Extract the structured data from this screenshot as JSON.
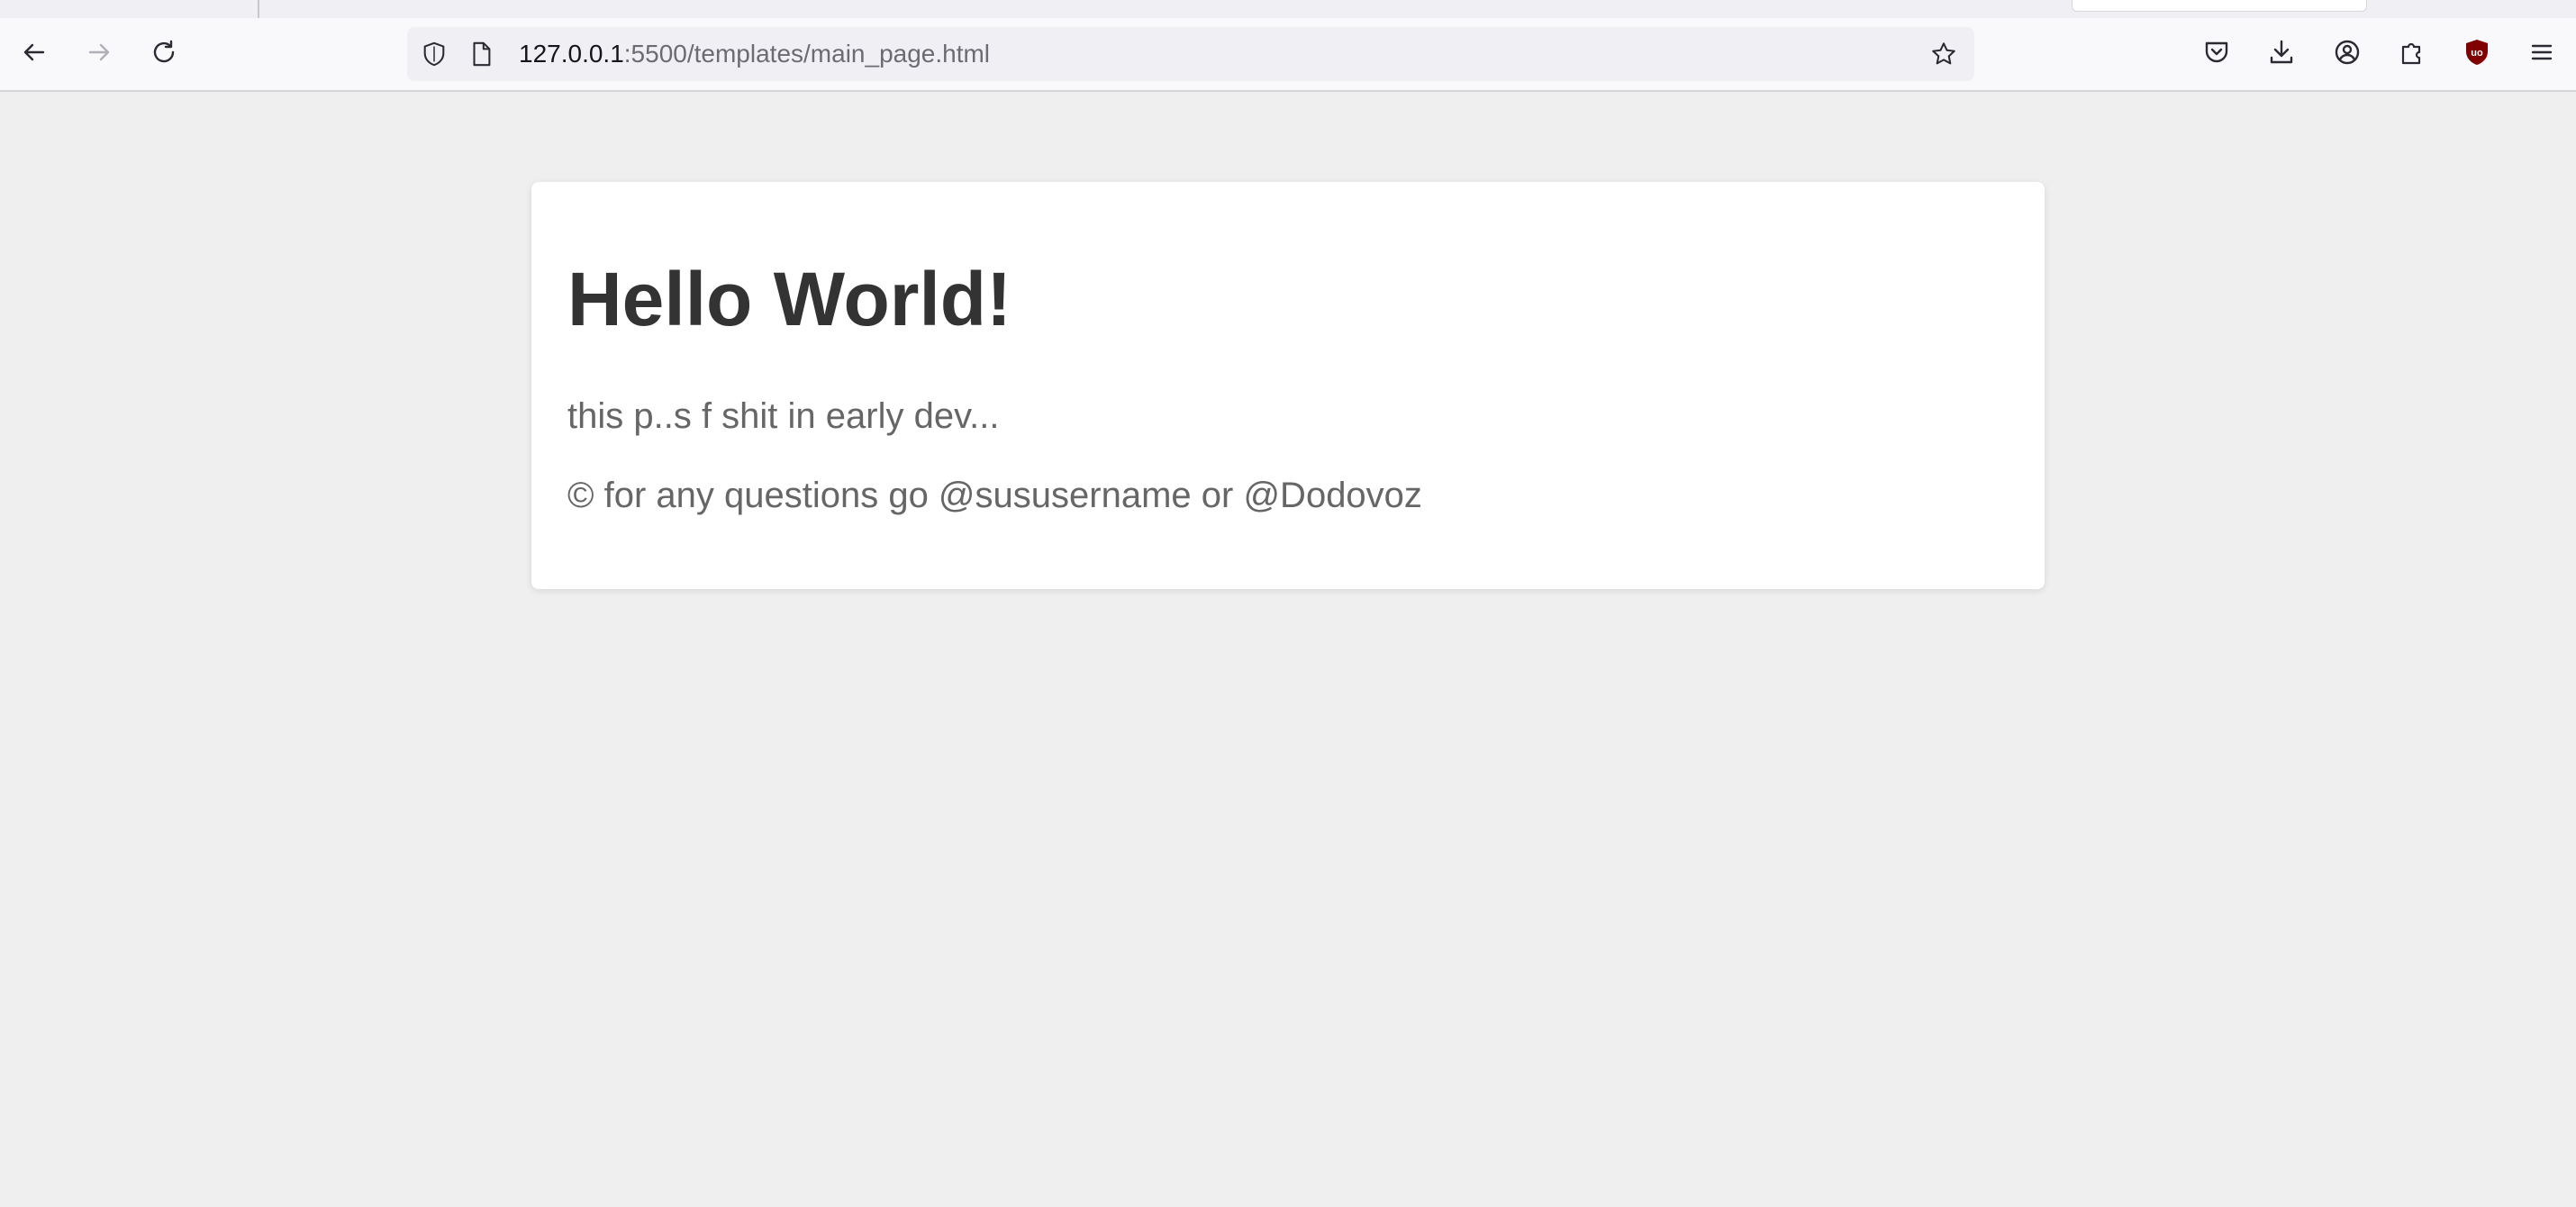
{
  "browser": {
    "url_host": "127.0.0.1",
    "url_path": ":5500/templates/main_page.html",
    "icons": {
      "back": "arrow-left-icon",
      "forward": "arrow-right-icon",
      "reload": "reload-icon",
      "tracking": "shield-icon",
      "page": "page-icon",
      "bookmark": "star-icon",
      "pocket": "pocket-icon",
      "downloads": "download-icon",
      "account": "account-icon",
      "extensions": "puzzle-icon",
      "ublock": "ublock-shield-icon",
      "menu": "hamburger-menu-icon"
    },
    "ublock_color": "#800000"
  },
  "page": {
    "heading": "Hello World!",
    "line_1": "this p..s f shit in early dev...",
    "line_2": "© for any questions go @sususername or @Dodovoz",
    "colors": {
      "background": "#efefef",
      "card": "#ffffff",
      "heading": "#333333",
      "text": "#666666"
    }
  }
}
